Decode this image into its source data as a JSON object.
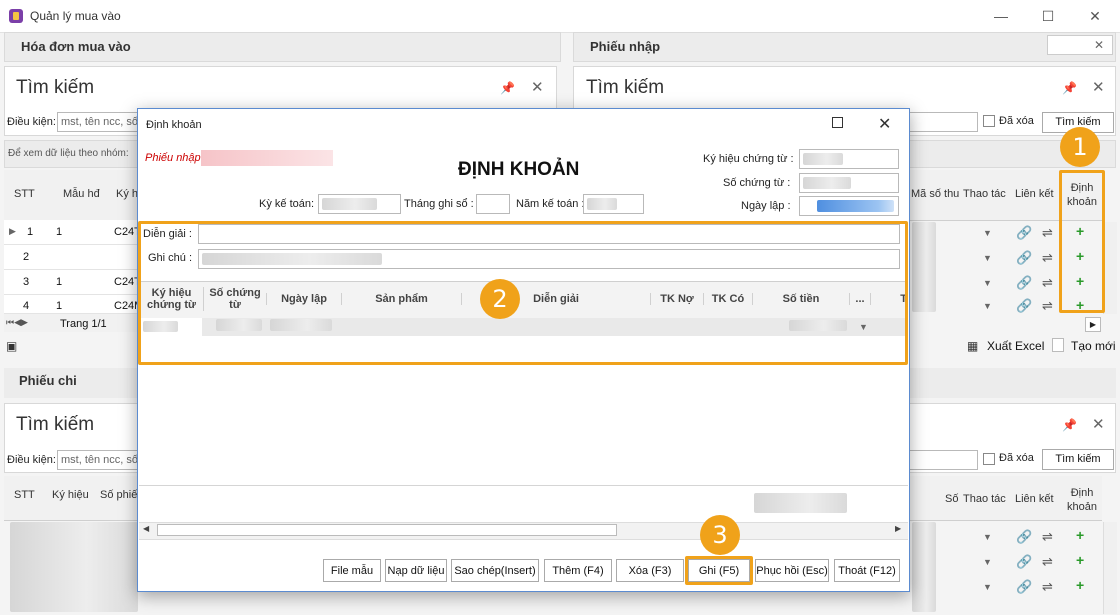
{
  "window": {
    "title": "Quản lý mua vào"
  },
  "left_panel": {
    "header": "Hóa đơn mua vào"
  },
  "right_panel": {
    "header": "Phiếu nhập"
  },
  "bottom_panel": {
    "header": "Phiếu chi"
  },
  "search": {
    "title": "Tìm kiếm",
    "condition_label": "Điều kiện:",
    "placeholder": "mst, tên ncc, số",
    "delete_label": "Đã xóa",
    "search_button": "Tìm kiếm",
    "group_hint": "Để xem dữ liệu theo nhóm:"
  },
  "invoice_grid": {
    "headers": [
      "STT",
      "Mẫu hđ",
      "Ký h"
    ],
    "rows": [
      {
        "stt": "1",
        "mau": "1",
        "ky": "C24T"
      },
      {
        "stt": "2",
        "mau": "",
        "ky": ""
      },
      {
        "stt": "3",
        "mau": "1",
        "ky": "C24T"
      },
      {
        "stt": "4",
        "mau": "1",
        "ky": "C24M"
      }
    ],
    "pager": "Trang 1/1"
  },
  "receipt_grid": {
    "headers": [
      "Mã số thu",
      "Thao tác",
      "Liên kết",
      "Định khoản"
    ],
    "export_label": "Xuất Excel",
    "new_label": "Tạo mới"
  },
  "payment_grid": {
    "headers": [
      "STT",
      "Ký hiệu",
      "Số phiế",
      "Số",
      "Thao tác",
      "Liên kết",
      "Định khoản"
    ]
  },
  "dialog": {
    "window_title": "Định khoản",
    "doc_type": "Phiếu nhập",
    "heading": "ĐỊNH KHOẢN",
    "ky_hieu_label": "Ký hiệu chứng từ :",
    "so_chung_tu_label": "Số chứng từ :",
    "ngay_lap_label": "Ngày lập :",
    "ky_ke_toan_label": "Kỳ kế toán:",
    "thang_ghi_so_label": "Tháng ghi sổ :",
    "nam_ke_toan_label": "Năm kế toán :",
    "dien_giai_label": "Diễn giải :",
    "ghi_chu_label": "Ghi chú :",
    "grid_headers": [
      "Ký hiệu chứng từ",
      "Số chứng từ",
      "Ngày lập",
      "Sản phẩm",
      "Diễn giải",
      "TK Nợ",
      "TK Có",
      "Số tiền",
      "...",
      "T"
    ],
    "buttons": [
      "File mẫu",
      "Nạp dữ liệu",
      "Sao chép(Insert)",
      "Thêm (F4)",
      "Xóa (F3)",
      "Ghi (F5)",
      "Phục hồi (Esc)",
      "Thoát (F12)"
    ]
  },
  "badges": [
    "1",
    "2",
    "3"
  ],
  "colors": {
    "highlight": "#f0a21a",
    "plus": "#2a9a2a",
    "doc_type": "#cc0000",
    "dialog_border": "#5b8bd0"
  }
}
